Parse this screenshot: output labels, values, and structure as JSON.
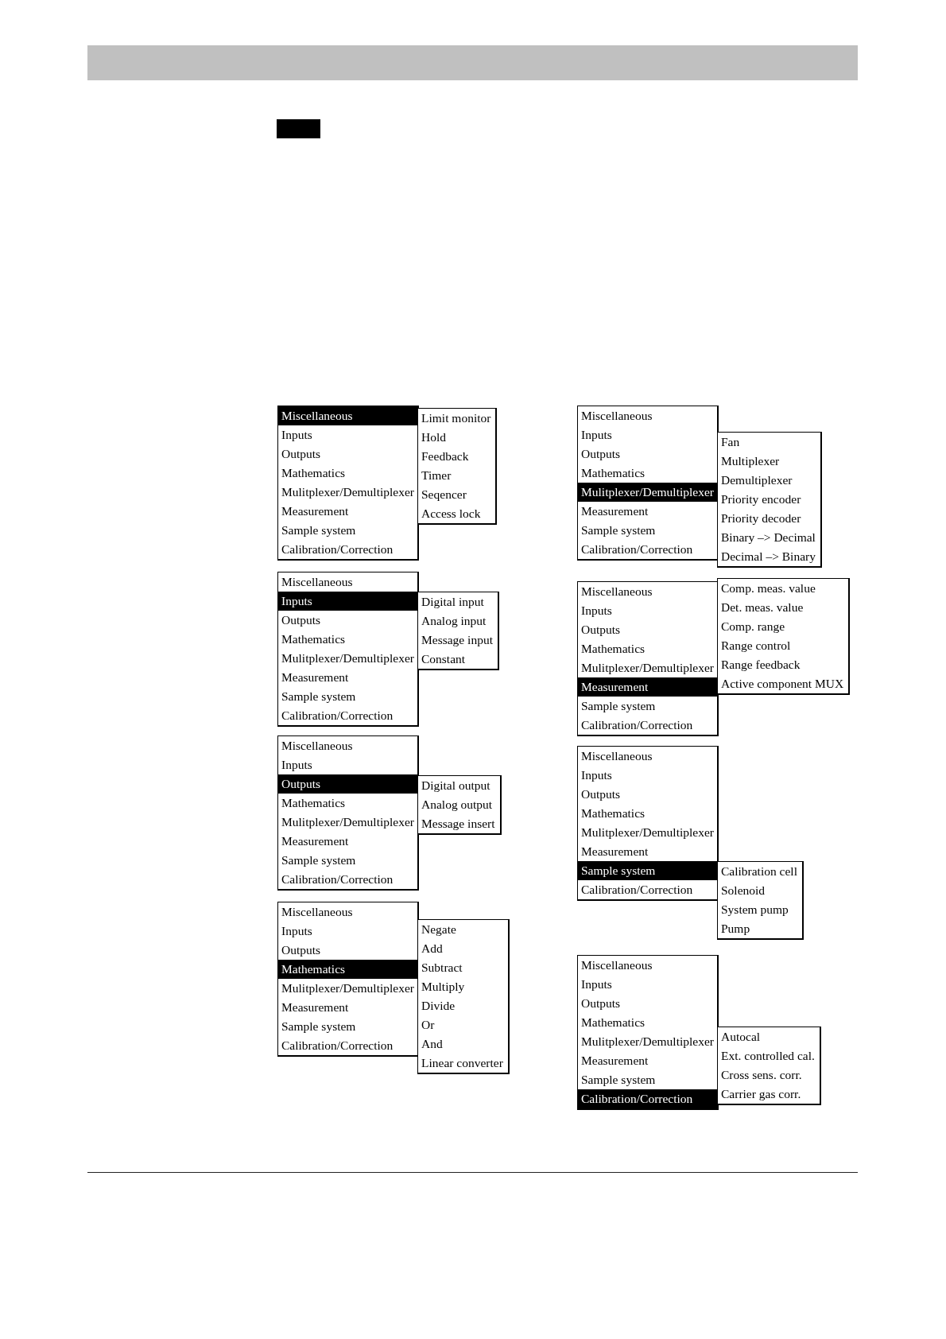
{
  "columns": [
    {
      "menus": [
        {
          "items": [
            {
              "label": "Miscellaneous",
              "selected": true
            },
            {
              "label": "Inputs",
              "selected": false
            },
            {
              "label": "Outputs",
              "selected": false
            },
            {
              "label": "Mathematics",
              "selected": false
            },
            {
              "label": "Mulitplexer/Demultiplexer",
              "selected": false
            },
            {
              "label": "Measurement",
              "selected": false
            },
            {
              "label": "Sample system",
              "selected": false
            },
            {
              "label": "Calibration/Correction",
              "selected": false
            }
          ],
          "submenu": [
            {
              "label": "Limit monitor",
              "selected": false
            },
            {
              "label": "Hold",
              "selected": false
            },
            {
              "label": "Feedback",
              "selected": false
            },
            {
              "label": "Timer",
              "selected": false
            },
            {
              "label": "Seqencer",
              "selected": false
            },
            {
              "label": "Access lock",
              "selected": false
            }
          ]
        },
        {
          "items": [
            {
              "label": "Miscellaneous",
              "selected": false
            },
            {
              "label": "Inputs",
              "selected": true
            },
            {
              "label": "Outputs",
              "selected": false
            },
            {
              "label": "Mathematics",
              "selected": false
            },
            {
              "label": "Mulitplexer/Demultiplexer",
              "selected": false
            },
            {
              "label": "Measurement",
              "selected": false
            },
            {
              "label": "Sample system",
              "selected": false
            },
            {
              "label": "Calibration/Correction",
              "selected": false
            }
          ],
          "submenu": [
            {
              "label": "Digital input",
              "selected": false
            },
            {
              "label": "Analog input",
              "selected": false
            },
            {
              "label": "Message input",
              "selected": false
            },
            {
              "label": "Constant",
              "selected": false
            }
          ]
        },
        {
          "items": [
            {
              "label": "Miscellaneous",
              "selected": false
            },
            {
              "label": "Inputs",
              "selected": false
            },
            {
              "label": "Outputs",
              "selected": true
            },
            {
              "label": "Mathematics",
              "selected": false
            },
            {
              "label": "Mulitplexer/Demultiplexer",
              "selected": false
            },
            {
              "label": "Measurement",
              "selected": false
            },
            {
              "label": "Sample system",
              "selected": false
            },
            {
              "label": "Calibration/Correction",
              "selected": false
            }
          ],
          "submenu": [
            {
              "label": "Digital output",
              "selected": false
            },
            {
              "label": "Analog output",
              "selected": false
            },
            {
              "label": "Message insert",
              "selected": false
            }
          ]
        },
        {
          "items": [
            {
              "label": "Miscellaneous",
              "selected": false
            },
            {
              "label": "Inputs",
              "selected": false
            },
            {
              "label": "Outputs",
              "selected": false
            },
            {
              "label": "Mathematics",
              "selected": true
            },
            {
              "label": "Mulitplexer/Demultiplexer",
              "selected": false
            },
            {
              "label": "Measurement",
              "selected": false
            },
            {
              "label": "Sample system",
              "selected": false
            },
            {
              "label": "Calibration/Correction",
              "selected": false
            }
          ],
          "submenu": [
            {
              "label": "Negate",
              "selected": false
            },
            {
              "label": "Add",
              "selected": false
            },
            {
              "label": "Subtract",
              "selected": false
            },
            {
              "label": "Multiply",
              "selected": false
            },
            {
              "label": "Divide",
              "selected": false
            },
            {
              "label": "Or",
              "selected": false
            },
            {
              "label": "And",
              "selected": false
            },
            {
              "label": "Linear converter",
              "selected": false
            }
          ]
        }
      ]
    },
    {
      "menus": [
        {
          "items": [
            {
              "label": "Miscellaneous",
              "selected": false
            },
            {
              "label": "Inputs",
              "selected": false
            },
            {
              "label": "Outputs",
              "selected": false
            },
            {
              "label": "Mathematics",
              "selected": false
            },
            {
              "label": "Mulitplexer/Demultiplexer",
              "selected": true
            },
            {
              "label": "Measurement",
              "selected": false
            },
            {
              "label": "Sample system",
              "selected": false
            },
            {
              "label": "Calibration/Correction",
              "selected": false
            }
          ],
          "submenu": [
            {
              "label": "Fan",
              "selected": false
            },
            {
              "label": "Multiplexer",
              "selected": false
            },
            {
              "label": "Demultiplexer",
              "selected": false
            },
            {
              "label": "Priority encoder",
              "selected": false
            },
            {
              "label": "Priority decoder",
              "selected": false
            },
            {
              "label": "Binary –> Decimal",
              "selected": false
            },
            {
              "label": "Decimal –> Binary",
              "selected": false
            }
          ]
        },
        {
          "items": [
            {
              "label": "Miscellaneous",
              "selected": false
            },
            {
              "label": "Inputs",
              "selected": false
            },
            {
              "label": "Outputs",
              "selected": false
            },
            {
              "label": "Mathematics",
              "selected": false
            },
            {
              "label": "Mulitplexer/Demultiplexer",
              "selected": false
            },
            {
              "label": "Measurement",
              "selected": true
            },
            {
              "label": "Sample system",
              "selected": false
            },
            {
              "label": "Calibration/Correction",
              "selected": false
            }
          ],
          "submenu": [
            {
              "label": "Comp. meas. value",
              "selected": false
            },
            {
              "label": "Det. meas. value",
              "selected": false
            },
            {
              "label": "Comp. range",
              "selected": false
            },
            {
              "label": "Range control",
              "selected": false
            },
            {
              "label": "Range feedback",
              "selected": false
            },
            {
              "label": "Active component MUX",
              "selected": false
            }
          ]
        },
        {
          "items": [
            {
              "label": "Miscellaneous",
              "selected": false
            },
            {
              "label": "Inputs",
              "selected": false
            },
            {
              "label": "Outputs",
              "selected": false
            },
            {
              "label": "Mathematics",
              "selected": false
            },
            {
              "label": "Mulitplexer/Demultiplexer",
              "selected": false
            },
            {
              "label": "Measurement",
              "selected": false
            },
            {
              "label": "Sample system",
              "selected": true
            },
            {
              "label": "Calibration/Correction",
              "selected": false
            }
          ],
          "submenu": [
            {
              "label": "Calibration cell",
              "selected": false
            },
            {
              "label": "Solenoid",
              "selected": false
            },
            {
              "label": "System pump",
              "selected": false
            },
            {
              "label": "Pump",
              "selected": false
            }
          ]
        },
        {
          "items": [
            {
              "label": "Miscellaneous",
              "selected": false
            },
            {
              "label": "Inputs",
              "selected": false
            },
            {
              "label": "Outputs",
              "selected": false
            },
            {
              "label": "Mathematics",
              "selected": false
            },
            {
              "label": "Mulitplexer/Demultiplexer",
              "selected": false
            },
            {
              "label": "Measurement",
              "selected": false
            },
            {
              "label": "Sample system",
              "selected": false
            },
            {
              "label": "Calibration/Correction",
              "selected": true
            }
          ],
          "submenu": [
            {
              "label": "Autocal",
              "selected": false
            },
            {
              "label": "Ext. controlled cal.",
              "selected": false
            },
            {
              "label": "Cross sens. corr.",
              "selected": false
            },
            {
              "label": "Carrier gas corr.",
              "selected": false
            }
          ]
        }
      ]
    }
  ]
}
